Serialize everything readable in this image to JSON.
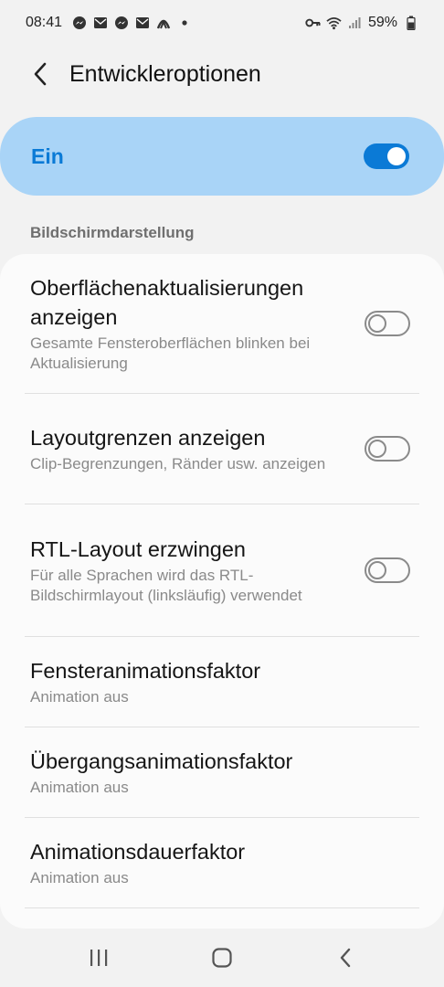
{
  "status_bar": {
    "time": "08:41",
    "battery": "59%",
    "left_icons": [
      "messenger-icon",
      "email-icon",
      "messenger-icon",
      "email-icon",
      "app-icon",
      "dot-icon"
    ],
    "right_icons": [
      "vpn-key-icon",
      "wifi-icon",
      "signal-icon",
      "battery-icon"
    ]
  },
  "header": {
    "title": "Entwickleroptionen"
  },
  "master": {
    "label": "Ein",
    "state": "on"
  },
  "section": {
    "heading": "Bildschirmdarstellung"
  },
  "items": [
    {
      "title": "Oberflächenaktualisierungen anzeigen",
      "subtitle": "Gesamte Fensteroberflächen blinken bei Aktualisierung",
      "toggle": "off"
    },
    {
      "title": "Layoutgrenzen anzeigen",
      "subtitle": "Clip-Begrenzungen, Ränder usw. anzeigen",
      "toggle": "off"
    },
    {
      "title": "RTL-Layout erzwingen",
      "subtitle": "Für alle Sprachen wird das RTL-Bildschirmlayout (linksläufig) verwendet",
      "toggle": "off"
    },
    {
      "title": "Fensteranimationsfaktor",
      "subtitle": "Animation aus"
    },
    {
      "title": "Übergangsanimationsfaktor",
      "subtitle": "Animation aus"
    },
    {
      "title": "Animationsdauerfaktor",
      "subtitle": "Animation aus"
    }
  ],
  "colors": {
    "accent": "#0b7ad6",
    "master_bg": "#a9d4f7",
    "background": "#f2f2f2",
    "card": "#fbfbfb"
  }
}
